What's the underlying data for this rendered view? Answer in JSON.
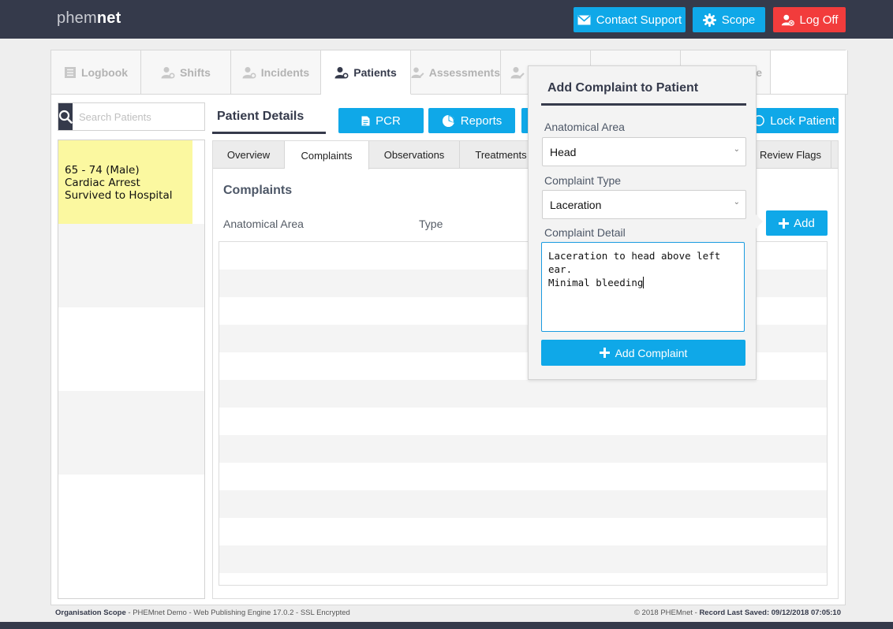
{
  "app": {
    "logo_light": "phem",
    "logo_bold": "net"
  },
  "header": {
    "contact_label": "Contact Support",
    "scope_label": "Scope",
    "logoff_label": "Log Off"
  },
  "main_tabs": [
    {
      "label": "Logbook",
      "icon": "logbook-icon"
    },
    {
      "label": "Shifts",
      "icon": "user-cog-icon"
    },
    {
      "label": "Incidents",
      "icon": "user-cog-icon"
    },
    {
      "label": "Patients",
      "icon": "user-cog-icon",
      "active": true
    },
    {
      "label": "Assessments",
      "icon": "user-edit-icon"
    },
    {
      "label": "",
      "icon": "user-edit-icon"
    },
    {
      "label": ""
    },
    {
      "label": "e"
    },
    {
      "label": ""
    }
  ],
  "search": {
    "placeholder": "Search Patients"
  },
  "patients": [
    {
      "line1": "65 - 74 (Male)",
      "line2": "Cardiac Arrest",
      "line3": "Survived to Hospital"
    }
  ],
  "patient_details": {
    "title": "Patient Details",
    "pcr_label": "PCR",
    "reports_label": "Reports",
    "lock_label": "Lock Patient"
  },
  "subtabs": [
    "Overview",
    "Complaints",
    "Observations",
    "Treatments",
    "Review Flags"
  ],
  "complaints": {
    "title": "Complaints",
    "col_area": "Anatomical Area",
    "col_type": "Type",
    "add_label": "Add"
  },
  "popover": {
    "title": "Add Complaint to Patient",
    "area_label": "Anatomical Area",
    "area_value": "Head",
    "type_label": "Complaint Type",
    "type_value": "Laceration",
    "detail_label": "Complaint Detail",
    "detail_line1": "Laceration to head above left ear.",
    "detail_line2": "Minimal bleeding",
    "submit_label": "Add Complaint"
  },
  "footer": {
    "left_bold": "Organisation Scope",
    "left_text": " - PHEMnet Demo - Web Publishing Engine 17.0.2 - SSL Encrypted",
    "right_text": "© 2018 PHEMnet - ",
    "right_bold": "Record Last Saved: 09/12/2018 07:05:10"
  },
  "colors": {
    "navy": "#353a4b",
    "accent": "#0fa8e8",
    "danger": "#f23c3c",
    "highlight": "#fbf8a0"
  }
}
